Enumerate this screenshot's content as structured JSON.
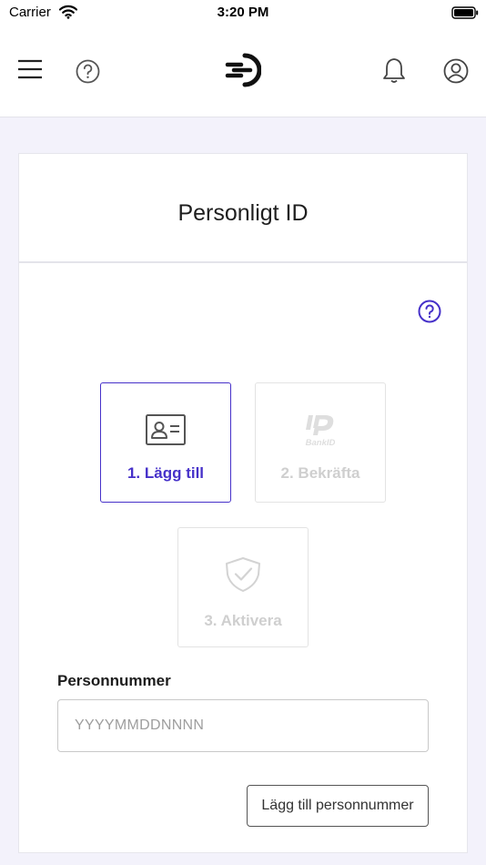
{
  "status_bar": {
    "carrier": "Carrier",
    "time": "3:20 PM"
  },
  "header": {
    "icons": [
      "menu-icon",
      "help-icon",
      "logo-icon",
      "bell-icon",
      "user-icon"
    ]
  },
  "card": {
    "title": "Personligt ID",
    "steps": [
      {
        "label": "1. Lägg till",
        "icon": "id-card-icon",
        "state": "active"
      },
      {
        "label": "2. Bekräfta",
        "icon": "bankid-icon",
        "logo_text": "BankID",
        "state": "inactive"
      },
      {
        "label": "3. Aktivera",
        "icon": "shield-check-icon",
        "state": "inactive"
      }
    ],
    "personnummer": {
      "label": "Personnummer",
      "placeholder": "YYYYMMDDNNNN",
      "value": ""
    },
    "add_button_label": "Lägg till personnummer"
  },
  "colors": {
    "accent": "#4631c9",
    "background": "#f3f2fb",
    "inactive": "#cfcfcf"
  }
}
